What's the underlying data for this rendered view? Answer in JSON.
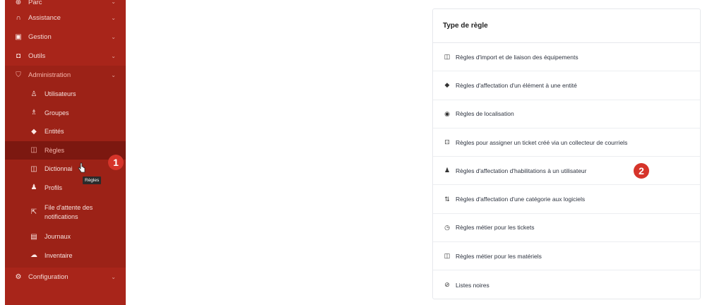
{
  "sidebar": {
    "sections_top": [
      {
        "label": "Parc",
        "icon": "box-icon"
      },
      {
        "label": "Assistance",
        "icon": "headset-icon"
      },
      {
        "label": "Gestion",
        "icon": "wallet-icon"
      },
      {
        "label": "Outils",
        "icon": "briefcase-icon"
      }
    ],
    "admin": {
      "label": "Administration",
      "icon": "shield-icon"
    },
    "admin_items": [
      {
        "label": "Utilisateurs",
        "icon": "user-icon"
      },
      {
        "label": "Groupes",
        "icon": "users-icon"
      },
      {
        "label": "Entités",
        "icon": "stack-icon"
      },
      {
        "label": "Règles",
        "icon": "book-icon"
      },
      {
        "label": "Dictionnai",
        "icon": "book-icon"
      },
      {
        "label": "Profils",
        "icon": "user-check-icon"
      },
      {
        "label": "File d'attente des notifications",
        "icon": "share-icon"
      },
      {
        "label": "Journaux",
        "icon": "news-icon"
      },
      {
        "label": "Inventaire",
        "icon": "cloud-icon"
      }
    ],
    "sections_bottom": [
      {
        "label": "Configuration",
        "icon": "settings-icon"
      }
    ],
    "tooltip": "Règles",
    "chevron": "⌄"
  },
  "badges": {
    "one": "1",
    "two": "2"
  },
  "panel": {
    "title": "Type de règle",
    "rules": [
      {
        "label": "Règles d'import et de liaison des équipements",
        "icon": "book-icon"
      },
      {
        "label": "Règles d'affectation d'un élément à une entité",
        "icon": "stack-icon"
      },
      {
        "label": "Règles de localisation",
        "icon": "location-icon"
      },
      {
        "label": "Règles pour assigner un ticket créé via un collecteur de courriels",
        "icon": "inbox-icon"
      },
      {
        "label": "Règles d'affectation d'habilitations à un utilisateur",
        "icon": "user-check-icon"
      },
      {
        "label": "Règles d'affectation d'une catégorie aux logiciels",
        "icon": "sort-icon"
      },
      {
        "label": "Règles métier pour les tickets",
        "icon": "clock-icon"
      },
      {
        "label": "Règles métier pour les matériels",
        "icon": "book-icon"
      },
      {
        "label": "Listes noires",
        "icon": "ban-icon"
      }
    ]
  }
}
